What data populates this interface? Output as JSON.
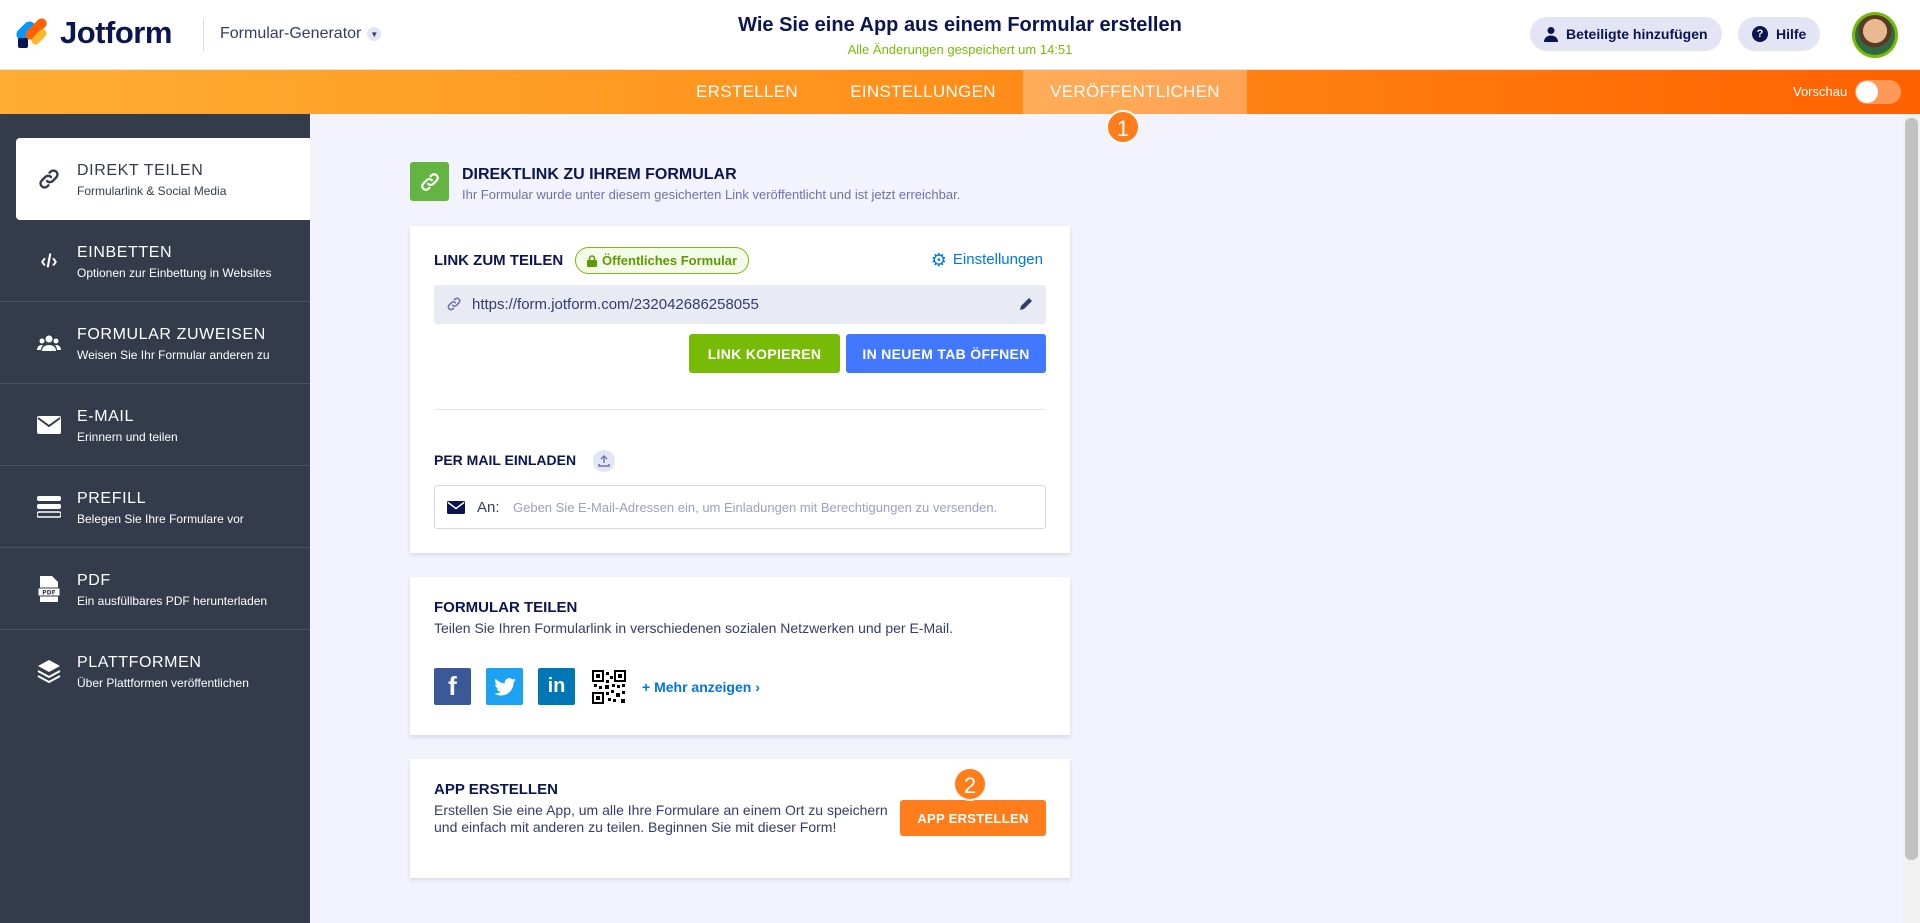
{
  "header": {
    "brand": "Jotform",
    "builder_menu": "Formular-Generator",
    "form_title": "Wie Sie eine App aus einem Formular erstellen",
    "save_status": "Alle Änderungen gespeichert um 14:51",
    "add_collaborators": "Beteiligte hinzufügen",
    "help": "Hilfe"
  },
  "nav": {
    "tabs": [
      "ERSTELLEN",
      "EINSTELLUNGEN",
      "VERÖFFENTLICHEN"
    ],
    "active_tab": "VERÖFFENTLICHEN",
    "preview_label": "Vorschau",
    "step1": "1"
  },
  "sidebar": {
    "items": [
      {
        "title": "DIREKT TEILEN",
        "subtitle": "Formularlink & Social Media",
        "icon": "link-icon"
      },
      {
        "title": "EINBETTEN",
        "subtitle": "Optionen zur Einbettung in Websites",
        "icon": "code-icon"
      },
      {
        "title": "FORMULAR ZUWEISEN",
        "subtitle": "Weisen Sie Ihr Formular anderen zu",
        "icon": "users-icon"
      },
      {
        "title": "E-MAIL",
        "subtitle": "Erinnern und teilen",
        "icon": "envelope-icon"
      },
      {
        "title": "PREFILL",
        "subtitle": "Belegen Sie Ihre Formulare vor",
        "icon": "prefill-icon"
      },
      {
        "title": "PDF",
        "subtitle": "Ein ausfüllbares PDF herunterladen",
        "icon": "pdf-icon"
      },
      {
        "title": "PLATTFORMEN",
        "subtitle": "Über Plattformen veröffentlichen",
        "icon": "layers-icon"
      }
    ]
  },
  "direct_link": {
    "title": "DIREKTLINK ZU IHREM FORMULAR",
    "subtitle": "Ihr Formular wurde unter diesem gesicherten Link veröffentlicht und ist jetzt erreichbar."
  },
  "share_card": {
    "title": "LINK ZUM TEILEN",
    "badge": "Öffentliches Formular",
    "settings": "Einstellungen",
    "url": "https://form.jotform.com/232042686258055",
    "copy_button": "LINK KOPIEREN",
    "open_button": "IN NEUEM TAB ÖFFNEN",
    "invite_title": "PER MAIL EINLADEN",
    "to_label": "An:",
    "email_placeholder": "Geben Sie E-Mail-Adressen ein, um Einladungen mit Berechtigungen zu versenden."
  },
  "social_card": {
    "title": "FORMULAR TEILEN",
    "subtitle": "Teilen Sie Ihren Formularlink in verschiedenen sozialen Netzwerken und per E-Mail.",
    "more": "+ Mehr anzeigen ›",
    "networks": [
      "facebook-icon",
      "twitter-icon",
      "linkedin-icon",
      "qr-code-icon"
    ]
  },
  "app_card": {
    "title": "APP ERSTELLEN",
    "description": "Erstellen Sie eine App, um alle Ihre Formulare an einem Ort zu speichern und einfach mit anderen zu teilen. Beginnen Sie mit dieser Form!",
    "button": "APP ERSTELLEN",
    "step2": "2"
  },
  "colors": {
    "brand_navy": "#0a1551",
    "accent_orange": "#ff6100",
    "green": "#78bb07",
    "blue": "#4277ff",
    "sidebar_bg": "#343c4c"
  }
}
